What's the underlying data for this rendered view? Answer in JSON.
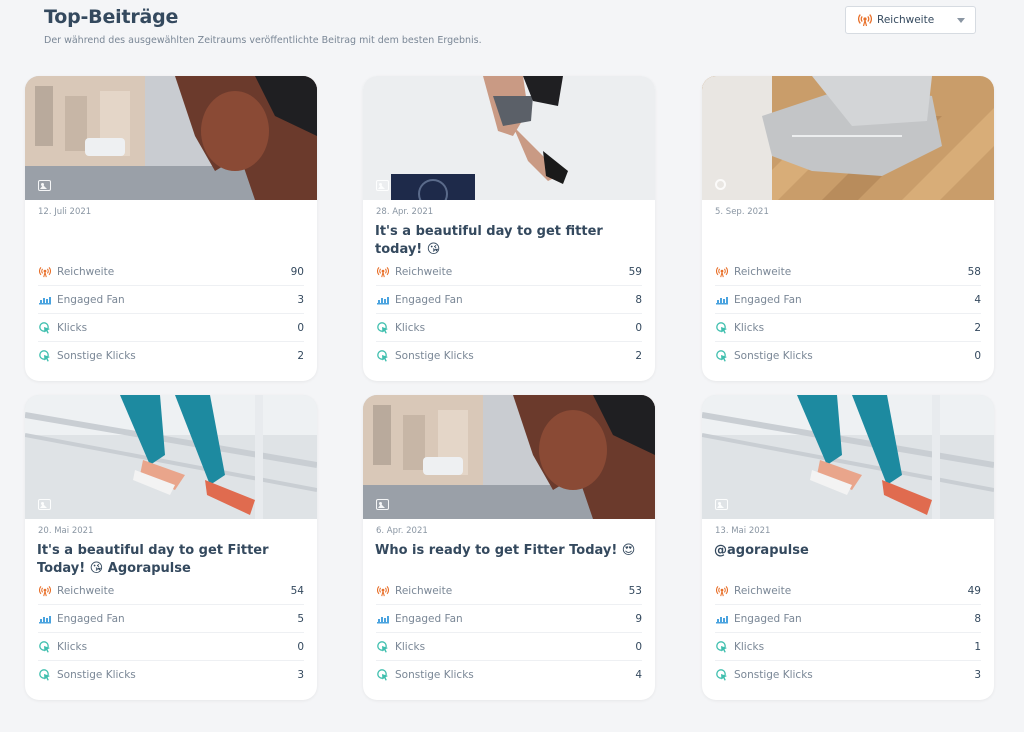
{
  "header": {
    "title": "Top-Beiträge",
    "subtitle": "Der während des ausgewählten Zeitraums veröffentlichte Beitrag mit dem besten Ergebnis."
  },
  "dropdown": {
    "selected": "Reichweite",
    "icon": "reach-icon"
  },
  "colors": {
    "reach": "#e8702a",
    "engaged": "#4aa3df",
    "clicks": "#3fbfae"
  },
  "metric_labels": {
    "reach": "Reichweite",
    "engaged": "Engaged Fan",
    "clicks": "Klicks",
    "other_clicks": "Sonstige Klicks"
  },
  "posts": [
    {
      "date": "12. Juli 2021",
      "caption": "",
      "media": "image-icon",
      "reach": "90",
      "engaged": "3",
      "clicks": "0",
      "other_clicks": "2"
    },
    {
      "date": "28. Apr. 2021",
      "caption": "It's a beautiful day to get fitter today! 😘",
      "media": "image-icon",
      "reach": "59",
      "engaged": "8",
      "clicks": "0",
      "other_clicks": "2"
    },
    {
      "date": "5. Sep. 2021",
      "caption": "",
      "media": "link-icon",
      "reach": "58",
      "engaged": "4",
      "clicks": "2",
      "other_clicks": "0"
    },
    {
      "date": "20. Mai 2021",
      "caption": "It's a beautiful day to get Fitter Today! 😘 Agorapulse",
      "media": "image-icon",
      "reach": "54",
      "engaged": "5",
      "clicks": "0",
      "other_clicks": "3"
    },
    {
      "date": "6. Apr. 2021",
      "caption": "Who is ready to get Fitter Today! 😍",
      "media": "image-icon",
      "reach": "53",
      "engaged": "9",
      "clicks": "0",
      "other_clicks": "4"
    },
    {
      "date": "13. Mai 2021",
      "caption": "@agorapulse",
      "media": "image-icon",
      "reach": "49",
      "engaged": "8",
      "clicks": "1",
      "other_clicks": "3"
    }
  ]
}
